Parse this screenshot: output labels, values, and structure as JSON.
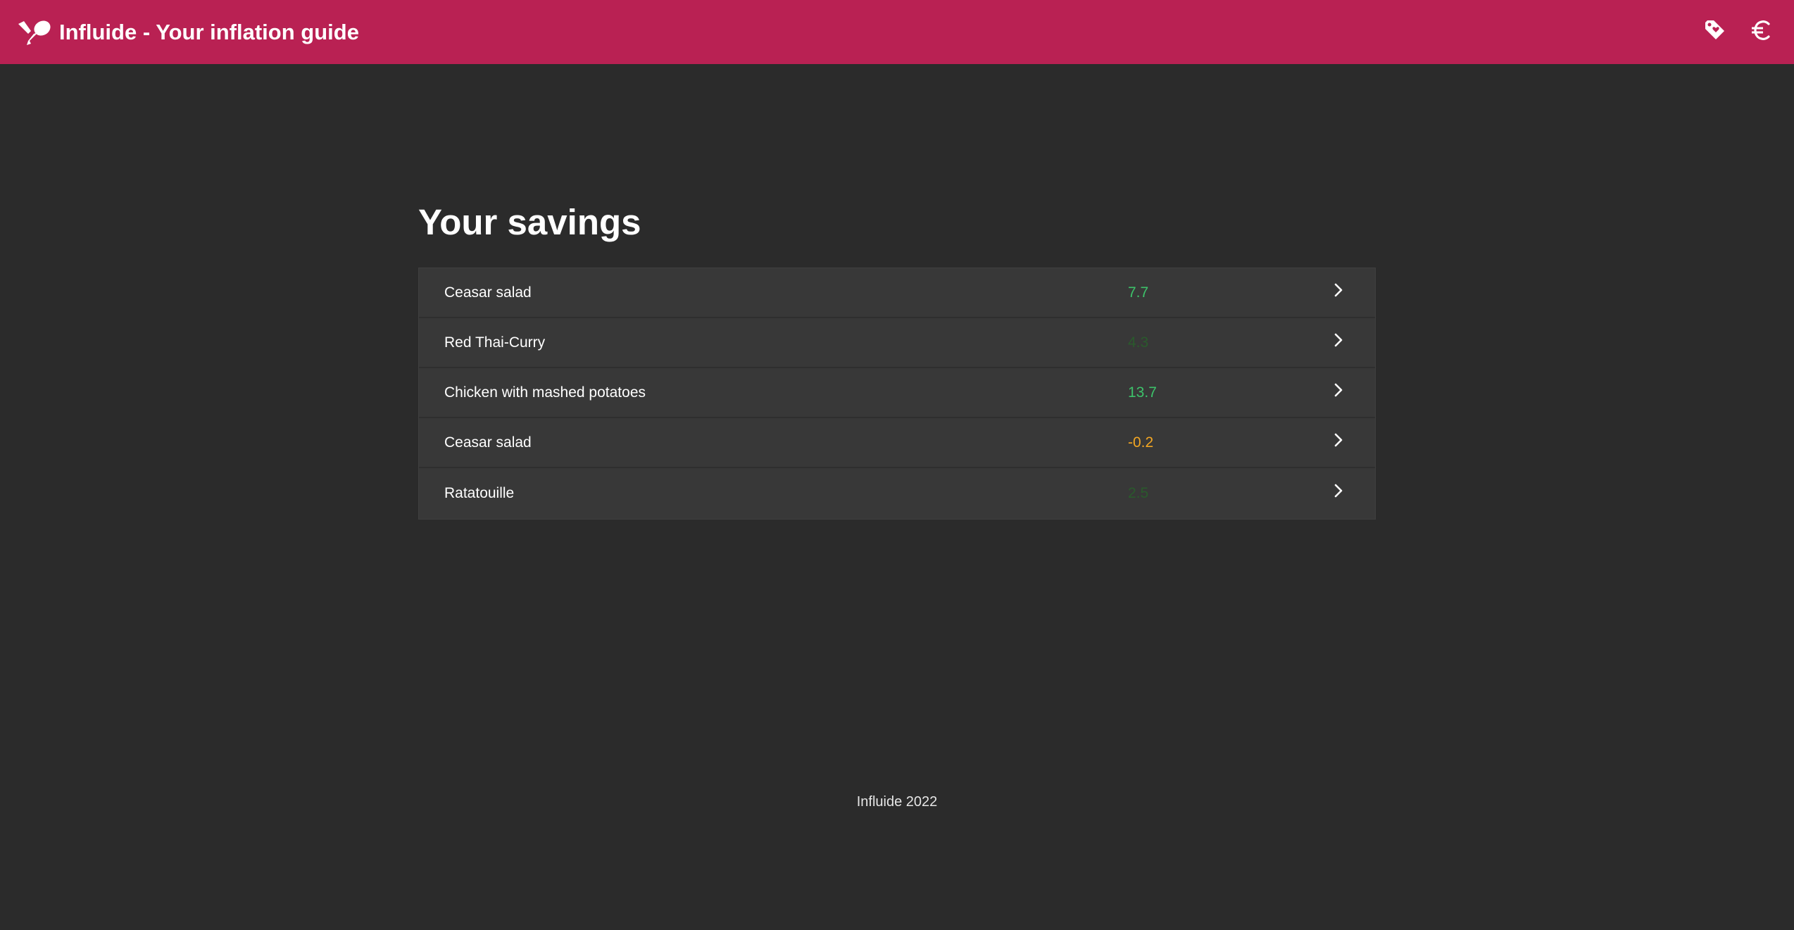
{
  "header": {
    "title": "Influide - Your inflation guide",
    "logo_icon": "chicken-leg-icon",
    "actions": [
      {
        "icon": "price-tag-icon"
      },
      {
        "icon": "euro-icon"
      }
    ],
    "background_color": "#b92153"
  },
  "main": {
    "title": "Your savings",
    "items": [
      {
        "name": "Ceasar salad",
        "value": "7.7",
        "value_color": "#3dc26a"
      },
      {
        "name": "Red Thai-Curry",
        "value": "4.3",
        "value_color": "#2a5a2c"
      },
      {
        "name": "Chicken with mashed potatoes",
        "value": "13.7",
        "value_color": "#3dc26a"
      },
      {
        "name": "Ceasar salad",
        "value": "-0.2",
        "value_color": "#f2a623"
      },
      {
        "name": "Ratatouille",
        "value": "2.5",
        "value_color": "#2a5a2c"
      }
    ]
  },
  "footer": {
    "text": "Influide 2022"
  }
}
